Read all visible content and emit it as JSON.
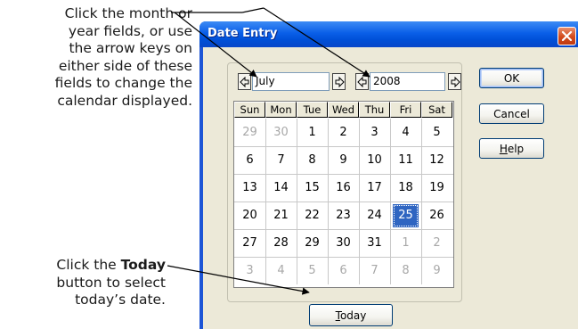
{
  "callouts": {
    "top_lines": [
      "Click the month or",
      "year fields, or use",
      "the arrow keys on",
      "either side of these",
      "fields to change the",
      "calendar displayed."
    ],
    "bottom_prefix": "Click the",
    "bottom_bold": "Today",
    "bottom_line2": "button to select",
    "bottom_line3": "today’s date."
  },
  "dialog": {
    "title": "Date Entry",
    "month_value": "July",
    "year_value": "2008",
    "ok_label": "OK",
    "cancel_label": "Cancel",
    "help_underline": "H",
    "help_rest": "elp",
    "today_underline": "T",
    "today_rest": "oday"
  },
  "calendar": {
    "day_headers": [
      "Sun",
      "Mon",
      "Tue",
      "Wed",
      "Thu",
      "Fri",
      "Sat"
    ],
    "weeks": [
      [
        {
          "d": "29",
          "o": true
        },
        {
          "d": "30",
          "o": true
        },
        {
          "d": "1"
        },
        {
          "d": "2"
        },
        {
          "d": "3"
        },
        {
          "d": "4"
        },
        {
          "d": "5"
        }
      ],
      [
        {
          "d": "6"
        },
        {
          "d": "7"
        },
        {
          "d": "8"
        },
        {
          "d": "9"
        },
        {
          "d": "10"
        },
        {
          "d": "11"
        },
        {
          "d": "12"
        }
      ],
      [
        {
          "d": "13"
        },
        {
          "d": "14"
        },
        {
          "d": "15"
        },
        {
          "d": "16"
        },
        {
          "d": "17"
        },
        {
          "d": "18"
        },
        {
          "d": "19"
        }
      ],
      [
        {
          "d": "20"
        },
        {
          "d": "21"
        },
        {
          "d": "22"
        },
        {
          "d": "23"
        },
        {
          "d": "24"
        },
        {
          "d": "25",
          "sel": true
        },
        {
          "d": "26"
        }
      ],
      [
        {
          "d": "27"
        },
        {
          "d": "28"
        },
        {
          "d": "29"
        },
        {
          "d": "30"
        },
        {
          "d": "31"
        },
        {
          "d": "1",
          "o": true
        },
        {
          "d": "2",
          "o": true
        }
      ],
      [
        {
          "d": "3",
          "o": true
        },
        {
          "d": "4",
          "o": true
        },
        {
          "d": "5",
          "o": true
        },
        {
          "d": "6",
          "o": true
        },
        {
          "d": "7",
          "o": true
        },
        {
          "d": "8",
          "o": true
        },
        {
          "d": "9",
          "o": true
        }
      ]
    ]
  },
  "icons": {
    "nav_left": "arrow-left-icon",
    "nav_right": "arrow-right-icon",
    "close": "close-icon"
  },
  "colors": {
    "titlebar": "#0a5fe8",
    "selection": "#2f65c1",
    "close_button": "#d2491b"
  }
}
